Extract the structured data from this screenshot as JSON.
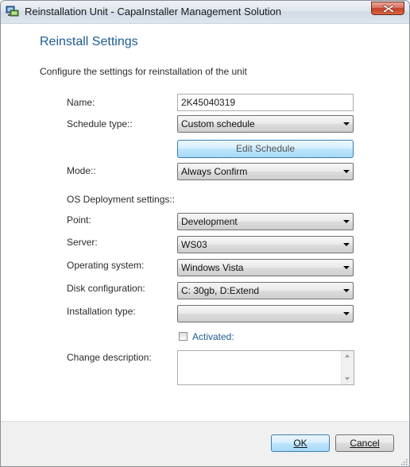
{
  "window": {
    "title": "Reinstallation Unit - CapaInstaller Management Solution",
    "app_icon": "computer-network-icon",
    "close_icon": "close-icon"
  },
  "header": {
    "heading": "Reinstall Settings",
    "intro": "Configure the settings for reinstallation of the unit"
  },
  "form": {
    "name_label": "Name:",
    "name_value": "2K45040319",
    "schedule_type_label": "Schedule type::",
    "schedule_type_value": "Custom schedule",
    "edit_schedule_label": "Edit Schedule",
    "mode_label": "Mode::",
    "mode_value": "Always Confirm",
    "os_section_label": "OS Deployment settings::",
    "point_label": "Point:",
    "point_value": "Development",
    "server_label": "Server:",
    "server_value": "WS03",
    "os_label": "Operating system:",
    "os_value": "Windows Vista",
    "disk_label": "Disk configuration:",
    "disk_value": "C: 30gb, D:Extend",
    "install_type_label": "Installation type:",
    "install_type_value": "",
    "activated_label": "Activated:",
    "activated_checked": false,
    "change_desc_label": "Change description:",
    "change_desc_value": ""
  },
  "footer": {
    "ok_label": "OK",
    "cancel_label": "Cancel"
  },
  "colors": {
    "heading_blue": "#1e5b93",
    "close_red": "#c0402b",
    "focus_blue": "#3c7fb1"
  }
}
